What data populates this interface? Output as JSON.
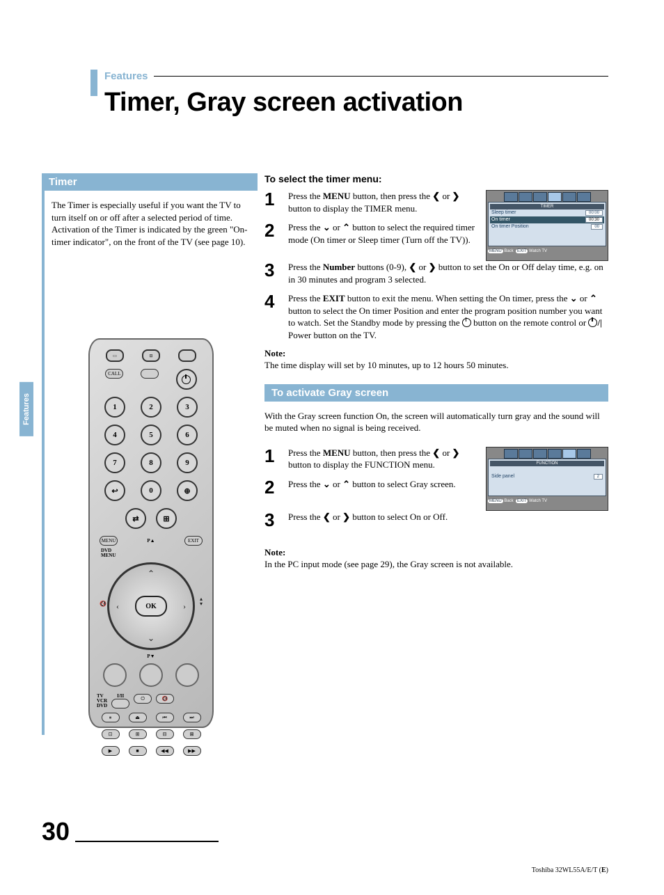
{
  "category": "Features",
  "title": "Timer, Gray screen activation",
  "sidebar_tab": "Features",
  "timer": {
    "header": "Timer",
    "intro": "The Timer is especially useful if you want the TV to turn itself on or off after a selected period of time.\nActivation of the Timer is indicated by the green \"On-timer indicator\", on the front of the TV (see page 10).",
    "select_hdr": "To select the timer menu:",
    "steps": {
      "1": "Press the MENU button, then press the ❮ or ❯ button to display the TIMER menu.",
      "2": "Press the ⌄ or ⌃ button to select the required timer mode (On timer or Sleep timer (Turn off the TV)).",
      "3": "Press the Number buttons (0-9), ❮ or ❯ button to set the On or Off delay time, e.g. on in 30 minutes and program 3 selected.",
      "4": "Press the EXIT button to exit the menu. When setting the On timer, press the ⌄ or ⌃ button to select the On timer Position and enter the program position number you want to watch. Set the Standby mode by pressing the ⏻ button on the remote control or ⏻/| Power button on the TV."
    },
    "note_label": "Note:",
    "note": "The time display will set by 10 minutes, up to 12 hours 50 minutes."
  },
  "gray": {
    "header": "To activate Gray screen",
    "intro": "With the Gray screen function On, the screen will automatically turn gray and the sound will be muted when no signal is being received.",
    "steps": {
      "1": "Press the MENU button, then press the ❮ or ❯ button to display the FUNCTION menu.",
      "2": "Press the ⌄ or ⌃ button to select Gray screen.",
      "3": "Press the ❮ or ❯ button to select On or Off."
    },
    "note_label": "Note:",
    "note": "In the PC input mode (see page 29), the Gray screen is not available."
  },
  "osd_timer": {
    "title": "TIMER",
    "rows": [
      {
        "label": "Sleep timer",
        "value": "00:00"
      },
      {
        "label": "On timer",
        "value": "00:30"
      },
      {
        "label": "On timer Position",
        "value": "00"
      }
    ],
    "menu": "MENU",
    "back": "Back",
    "exit": "EXIT",
    "watch": "Watch TV"
  },
  "osd_func": {
    "title": "FUNCTION",
    "rows": [
      {
        "label": "Side panel",
        "value": "2"
      }
    ],
    "menu": "MENU",
    "back": "Back",
    "exit": "EXIT",
    "watch": "Watch TV"
  },
  "remote": {
    "call": "CALL",
    "menu": "MENU",
    "exit": "EXIT",
    "ok": "OK",
    "dvd_menu": "DVD\nMENU",
    "p_up": "P▲",
    "p_down": "P▼",
    "selector": "TV\nVCR\nDVD",
    "audio": "I/II"
  },
  "page_number": "30",
  "model": "Toshiba 32WL55A/E/T (E)"
}
